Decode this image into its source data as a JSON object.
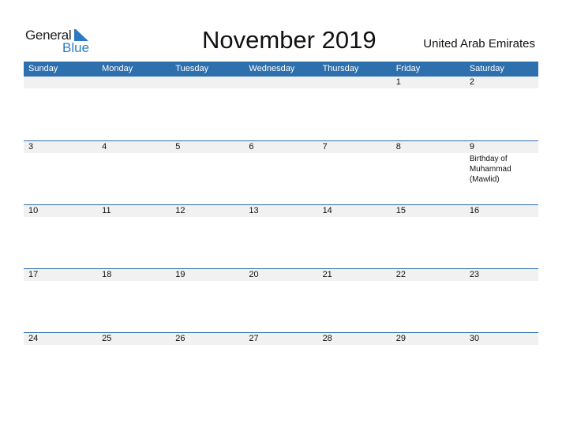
{
  "brand": {
    "word1": "General",
    "word2": "Blue",
    "color": "#2b7bc4"
  },
  "title": "November 2019",
  "country": "United Arab Emirates",
  "colors": {
    "header_bg": "#2e6fae",
    "date_bar": "#f1f1f1"
  },
  "weekdays": [
    "Sunday",
    "Monday",
    "Tuesday",
    "Wednesday",
    "Thursday",
    "Friday",
    "Saturday"
  ],
  "weeks": [
    {
      "days": [
        {
          "date": "",
          "event": ""
        },
        {
          "date": "",
          "event": ""
        },
        {
          "date": "",
          "event": ""
        },
        {
          "date": "",
          "event": ""
        },
        {
          "date": "",
          "event": ""
        },
        {
          "date": "1",
          "event": ""
        },
        {
          "date": "2",
          "event": ""
        }
      ]
    },
    {
      "days": [
        {
          "date": "3",
          "event": ""
        },
        {
          "date": "4",
          "event": ""
        },
        {
          "date": "5",
          "event": ""
        },
        {
          "date": "6",
          "event": ""
        },
        {
          "date": "7",
          "event": ""
        },
        {
          "date": "8",
          "event": ""
        },
        {
          "date": "9",
          "event": "Birthday of Muhammad (Mawlid)"
        }
      ]
    },
    {
      "days": [
        {
          "date": "10",
          "event": ""
        },
        {
          "date": "11",
          "event": ""
        },
        {
          "date": "12",
          "event": ""
        },
        {
          "date": "13",
          "event": ""
        },
        {
          "date": "14",
          "event": ""
        },
        {
          "date": "15",
          "event": ""
        },
        {
          "date": "16",
          "event": ""
        }
      ]
    },
    {
      "days": [
        {
          "date": "17",
          "event": ""
        },
        {
          "date": "18",
          "event": ""
        },
        {
          "date": "19",
          "event": ""
        },
        {
          "date": "20",
          "event": ""
        },
        {
          "date": "21",
          "event": ""
        },
        {
          "date": "22",
          "event": ""
        },
        {
          "date": "23",
          "event": ""
        }
      ]
    },
    {
      "days": [
        {
          "date": "24",
          "event": ""
        },
        {
          "date": "25",
          "event": ""
        },
        {
          "date": "26",
          "event": ""
        },
        {
          "date": "27",
          "event": ""
        },
        {
          "date": "28",
          "event": ""
        },
        {
          "date": "29",
          "event": ""
        },
        {
          "date": "30",
          "event": ""
        }
      ]
    }
  ]
}
